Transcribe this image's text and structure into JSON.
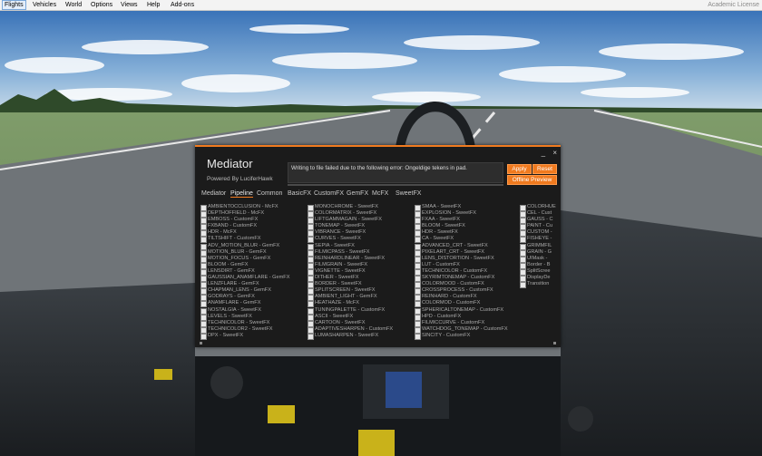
{
  "menubar": {
    "items": [
      "Flights",
      "Vehicles",
      "World",
      "Options",
      "Views",
      "Help",
      "Add-ons"
    ],
    "right_text": "Academic License"
  },
  "mediator": {
    "title": "Mediator",
    "subtitle": "Powered By LuciferHawk",
    "log_message": "Writing to file failed due to the following error: Ongeldige tekens in pad.",
    "buttons": {
      "apply": "Apply",
      "reset": "Reset",
      "preview": "Offline Preview"
    },
    "window_controls": {
      "minimize": "_",
      "close": "×"
    },
    "tabs": [
      "Mediator",
      "Pipeline",
      "Common",
      "BasicFX",
      "CustomFX",
      "GemFX",
      "McFX",
      "SweetFX"
    ],
    "selected_tab": "Pipeline",
    "columns": [
      [
        "AMBIENTOCCLUSION - McFX",
        "DEPTHOFFIELD - McFX",
        "EMBOSS - CustomFX",
        "FXBAND - CustomFX",
        "HDR - McFX",
        "TILTSHIFT - CustomFX",
        "ADV_MOTION_BLUR - GemFX",
        "MOTION_BLUR - GemFX",
        "MOTION_FOCUS - GemFX",
        "BLOOM - GemFX",
        "LENSDIRT - GemFX",
        "GAUSSIAN_ANAMFLARE - GemFX",
        "LENZFLARE - GemFX",
        "CHAPMAN_LENS - GemFX",
        "GODRAYS - GemFX",
        "ANAMFLARE - GemFX",
        "NOSTALGIA - SweetFX",
        "LEVELS - SweetFX",
        "TECHNICOLOR - SweetFX",
        "TECHNICOLOR2 - SweetFX",
        "DPX - SweetFX"
      ],
      [
        "MONOCHROME - SweetFX",
        "COLORMATRIX - SweetFX",
        "LIFTGAMMAGAIN - SweetFX",
        "TONEMAP - SweetFX",
        "VIBRANCE - SweetFX",
        "CURVES - SweetFX",
        "SEPIA - SweetFX",
        "FILMICPASS - SweetFX",
        "REINHARDLINEAR - SweetFX",
        "FILMGRAIN - SweetFX",
        "VIGNETTE - SweetFX",
        "DITHER - SweetFX",
        "BORDER - SweetFX",
        "SPLITSCREEN - SweetFX",
        "AMBIENT_LIGHT - GemFX",
        "HEATHAZE - McFX",
        "TUNINGPALETTE - CustomFX",
        "ASCII - SweetFX",
        "CARTOON - SweetFX",
        "ADAPTIVESHARPEN - CustomFX",
        "LUMASHARPEN - SweetFX"
      ],
      [
        "SMAA - SweetFX",
        "EXPLOSION - SweetFX",
        "FXAA - SweetFX",
        "BLOOM - SweetFX",
        "HDR - SweetFX",
        "CA - SweetFX",
        "ADVANCED_CRT - SweetFX",
        "PIXELART_CRT - SweetFX",
        "LENS_DISTORTION - SweetFX",
        "LUT - CustomFX",
        "TECHNICOLOR - CustomFX",
        "SKYRIMTONEMAP - CustomFX",
        "COLORMOOD - CustomFX",
        "CROSSPROCESS - CustomFX",
        "REINHARD - CustomFX",
        "COLORMOD - CustomFX",
        "SPHERICALTONEMAP - CustomFX",
        "HPD - CustomFX",
        "FILMICCURVE - CustomFX",
        "WATCHDOG_TONEMAP - CustomFX",
        "SINCITY - CustomFX"
      ],
      [
        "COLORHUE",
        "CEL - Cust",
        "GAUSS - C",
        "PAINT - Cu",
        "CUSTOM -",
        "FISHEYE -",
        "GRIMMFIL",
        "GRAIN - G",
        "UIMask - ",
        "Border - B",
        "SplitScree",
        "DisplayDe",
        "Transition"
      ]
    ]
  }
}
